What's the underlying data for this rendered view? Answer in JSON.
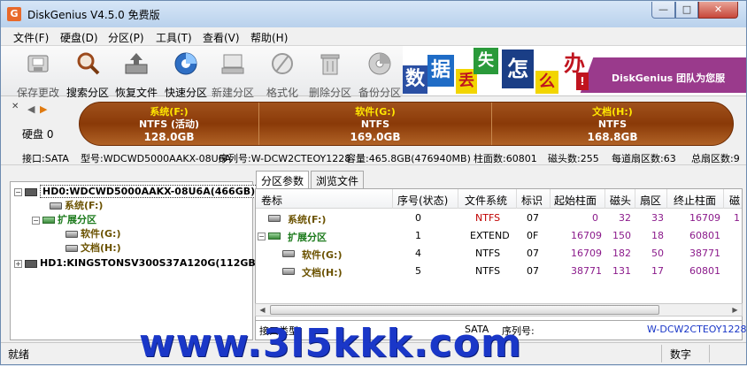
{
  "window": {
    "title": "DiskGenius V4.5.0 免费版",
    "icon_letter": "G",
    "minimize": "—",
    "maximize": "□",
    "close": "✕"
  },
  "menu": [
    "文件(F)",
    "硬盘(D)",
    "分区(P)",
    "工具(T)",
    "查看(V)",
    "帮助(H)"
  ],
  "toolbar": {
    "items": [
      {
        "label": "保存更改",
        "icon": "save-icon",
        "enabled": false
      },
      {
        "label": "搜索分区",
        "icon": "search-icon",
        "enabled": true
      },
      {
        "label": "恢复文件",
        "icon": "restore-icon",
        "enabled": true
      },
      {
        "label": "快速分区",
        "icon": "quick-partition-icon",
        "enabled": true
      },
      {
        "label": "新建分区",
        "icon": "new-partition-icon",
        "enabled": false
      },
      {
        "label": "格式化",
        "icon": "format-icon",
        "enabled": false
      },
      {
        "label": "删除分区",
        "icon": "delete-icon",
        "enabled": false
      },
      {
        "label": "备份分区",
        "icon": "backup-icon",
        "enabled": false
      }
    ],
    "banner": {
      "tiles": [
        "数",
        "据",
        "丢",
        "失",
        "怎",
        "么",
        "办",
        "!"
      ],
      "text": "DiskGenius 团队为您服"
    }
  },
  "diskmap": {
    "disk_label": "硬盘 0",
    "segments": [
      {
        "name": "系统(F:)",
        "fs": "NTFS (活动)",
        "size": "128.0GB"
      },
      {
        "name": "软件(G:)",
        "fs": "NTFS",
        "size": "169.0GB"
      },
      {
        "name": "文档(H:)",
        "fs": "NTFS",
        "size": "168.8GB"
      }
    ]
  },
  "infobar": {
    "interface": "接口:SATA",
    "model": "型号:WDCWD5000AAKX-08U6A",
    "serial": "序列号:W-DCW2CTEOY1228",
    "capacity": "容量:465.8GB(476940MB)",
    "cylinders": "柱面数:60801",
    "heads": "磁头数:255",
    "sectors_per_track": "每道扇区数:63",
    "total_sectors": "总扇区数:9"
  },
  "tree": {
    "disk0": "HD0:WDCWD5000AAKX-08U6A(466GB)",
    "p_system": "系统(F:)",
    "p_extended": "扩展分区",
    "p_software": "软件(G:)",
    "p_docs": "文档(H:)",
    "disk1": "HD1:KINGSTONSV300S37A120G(112GB)"
  },
  "tabs": [
    "分区参数",
    "浏览文件"
  ],
  "grid": {
    "headers": [
      "卷标",
      "序号(状态)",
      "文件系统",
      "标识",
      "起始柱面",
      "磁头",
      "扇区",
      "终止柱面",
      "磁"
    ],
    "rows": [
      {
        "label": "系统(F:)",
        "index": "0",
        "fs": "NTFS",
        "id": "07",
        "start_cyl": "0",
        "head": "32",
        "sector": "33",
        "end_cyl": "16709",
        "extra": "1"
      },
      {
        "label": "扩展分区",
        "index": "1",
        "fs": "EXTEND",
        "id": "0F",
        "start_cyl": "16709",
        "head": "150",
        "sector": "18",
        "end_cyl": "60801",
        "extra": ""
      },
      {
        "label": "软件(G:)",
        "index": "4",
        "fs": "NTFS",
        "id": "07",
        "start_cyl": "16709",
        "head": "182",
        "sector": "50",
        "end_cyl": "38771",
        "extra": ""
      },
      {
        "label": "文档(H:)",
        "index": "5",
        "fs": "NTFS",
        "id": "07",
        "start_cyl": "38771",
        "head": "131",
        "sector": "17",
        "end_cyl": "60801",
        "extra": ""
      }
    ]
  },
  "bottom_info": {
    "interface_label": "接口类型:",
    "interface_value": "SATA",
    "serial_label": "序列号:",
    "serial_value": "W-DCW2CTEOY1228"
  },
  "status": {
    "left": "就绪",
    "num": "数字"
  },
  "watermark": "www.3l5kkk.com",
  "colors": {
    "partition_bar": "#8a3a08",
    "partition_name": "#ffe600",
    "fs_ntfs": "#c00000",
    "number": "#8b1a8b",
    "extended": "#1b7a1b",
    "watermark": "#1a37c8"
  }
}
